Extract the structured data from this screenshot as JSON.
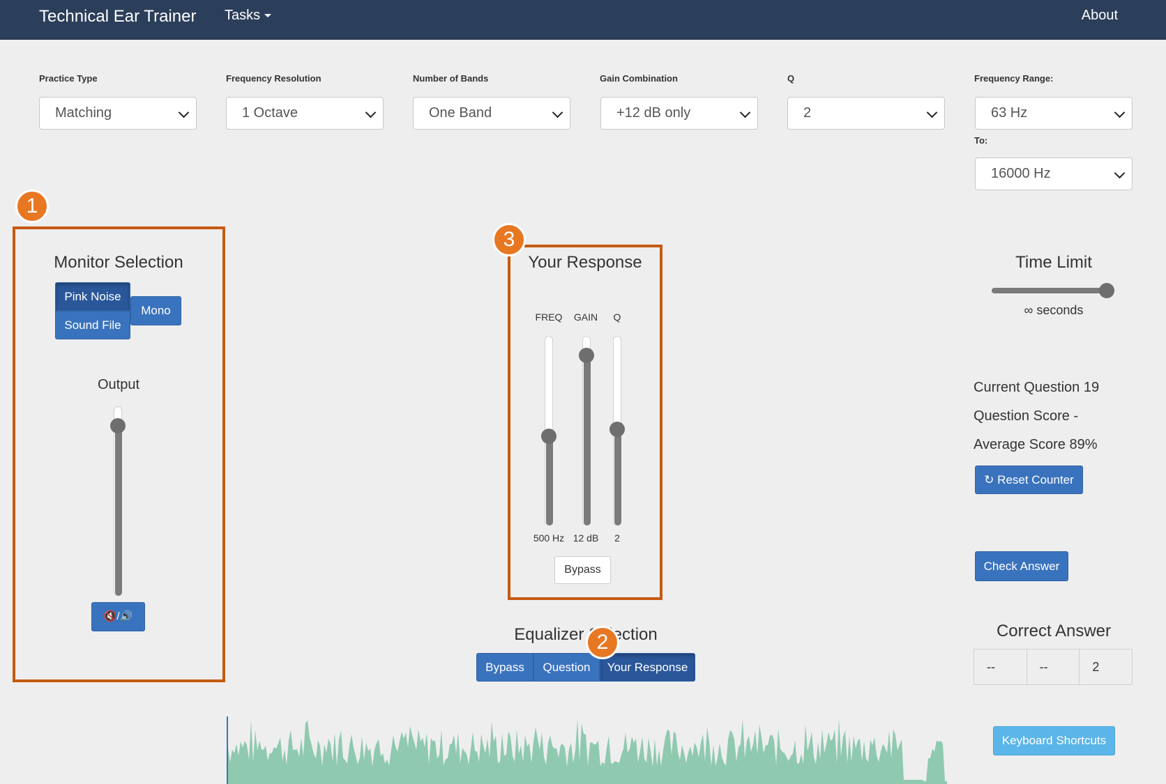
{
  "navbar": {
    "brand": "Technical Ear Trainer",
    "tasks": "Tasks",
    "about": "About"
  },
  "settings": {
    "practice_type": {
      "label": "Practice Type",
      "value": "Matching"
    },
    "frequency_resolution": {
      "label": "Frequency Resolution",
      "value": "1 Octave"
    },
    "number_of_bands": {
      "label": "Number of Bands",
      "value": "One Band"
    },
    "gain_combination": {
      "label": "Gain Combination",
      "value": "+12 dB only"
    },
    "q": {
      "label": "Q",
      "value": "2"
    },
    "frequency_range": {
      "label": "Frequency Range:",
      "from": "63 Hz",
      "to_label": "To:",
      "to": "16000 Hz"
    }
  },
  "monitor": {
    "title": "Monitor Selection",
    "pink_noise": "Pink Noise",
    "sound_file": "Sound File",
    "mono": "Mono",
    "output_label": "Output",
    "output_level": 0.93,
    "mute_button": "🔇/🔊"
  },
  "response": {
    "title": "Your Response",
    "freq_label": "FREQ",
    "gain_label": "GAIN",
    "q_label": "Q",
    "freq_value": "500 Hz",
    "gain_value": "12 dB",
    "q_value": "2",
    "freq_level": 0.47,
    "gain_level": 0.93,
    "q_level": 0.51,
    "bypass": "Bypass"
  },
  "equalizer": {
    "title": "Equalizer Selection",
    "bypass": "Bypass",
    "question": "Question",
    "your_response": "Your Response",
    "active": "your_response"
  },
  "time_limit": {
    "title": "Time Limit",
    "value": "∞ seconds",
    "level": 1.0
  },
  "stats": {
    "current_question": "Current Question 19",
    "question_score": "Question Score -",
    "average_score": "Average Score 89%",
    "reset_counter": "Reset Counter",
    "check_answer": "Check Answer"
  },
  "correct_answer": {
    "title": "Correct Answer",
    "cells": [
      "--",
      "--",
      "2"
    ]
  },
  "keyboard_shortcuts": "Keyboard Shortcuts",
  "annotations": [
    "1",
    "2",
    "3"
  ],
  "colors": {
    "accent": "#3a73bd",
    "navbar": "#2b3e5a",
    "annotation": "#c55a11",
    "waveform": "#8fc9b0"
  }
}
